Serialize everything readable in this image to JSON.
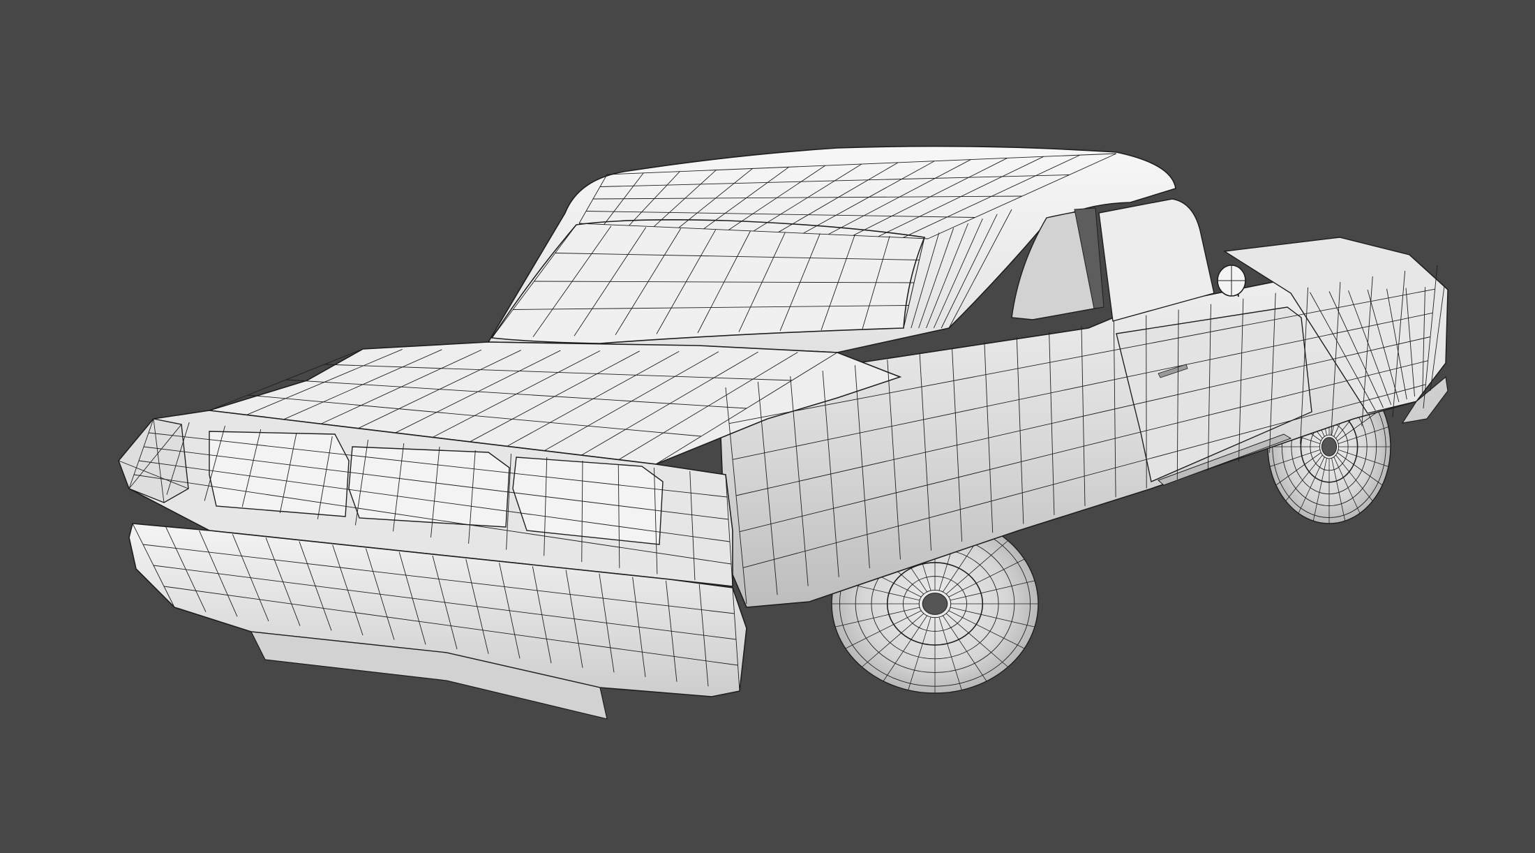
{
  "scene": {
    "subject": "car-wireframe-render",
    "colors": {
      "background": "#474747",
      "surface": "#f1f1f1",
      "surface_mid": "#dcdcdc",
      "surface_shadow": "#c3c3c3",
      "glass_dark": "#7b7b7b",
      "wire": "#1e1e1e"
    }
  }
}
